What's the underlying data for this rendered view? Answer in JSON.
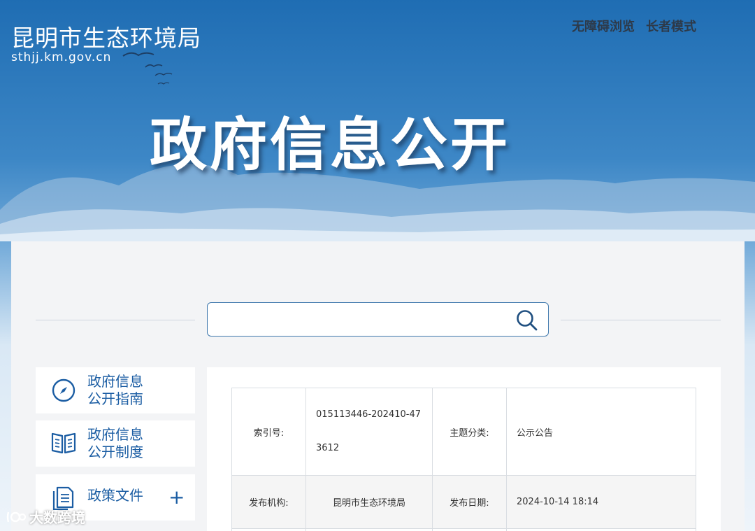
{
  "header": {
    "site_name": "昆明市生态环境局",
    "site_url": "sthjj.km.gov.cn",
    "links": [
      "无障碍浏览",
      "长者模式"
    ],
    "banner_title": "政府信息公开"
  },
  "search": {
    "value": "",
    "icon": "search-icon"
  },
  "sidebar": {
    "items": [
      {
        "label": "政府信息\n公开指南",
        "icon": "compass-icon"
      },
      {
        "label": "政府信息\n公开制度",
        "icon": "book-icon"
      },
      {
        "label": "政策文件",
        "icon": "document-icon",
        "expand_icon": "plus-icon"
      }
    ]
  },
  "meta_table": {
    "index_label": "索引号:",
    "index_value": "015113446-202410-473612",
    "topic_label": "主题分类:",
    "topic_value": "公示公告",
    "publisher_label": "发布机构:",
    "publisher_value": "昆明市生态环境局",
    "date_label": "发布日期:",
    "date_value": "2024-10-14 18:14"
  },
  "watermark": {
    "text": "大数跨境"
  },
  "colors": {
    "accent": "#1b5da3",
    "search_border": "#3f78ad",
    "banner_top": "#1f6db3"
  }
}
